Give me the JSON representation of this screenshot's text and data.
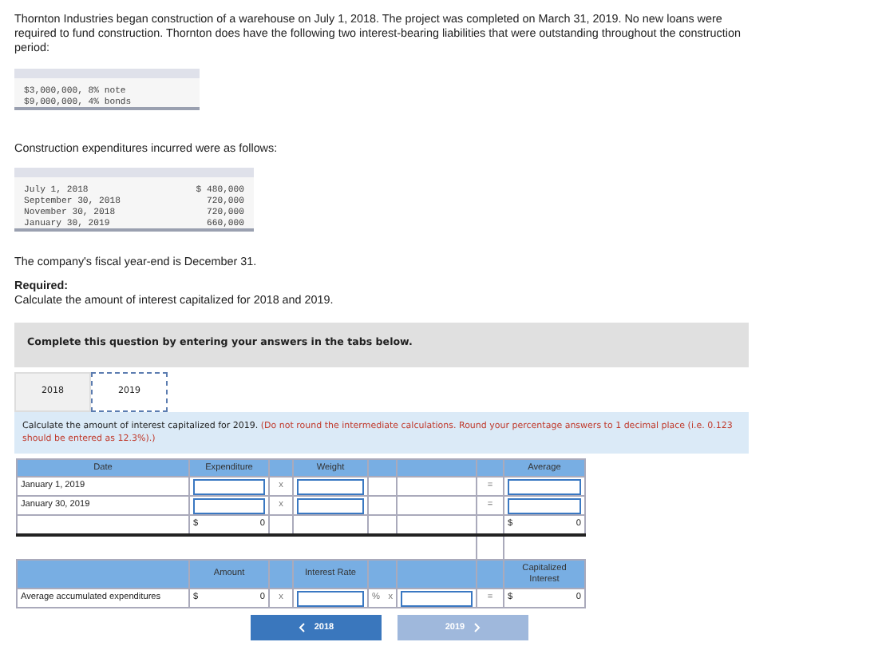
{
  "intro": "Thornton Industries began construction of a warehouse on July 1, 2018. The project was completed on March 31, 2019. No new loans were required to fund construction. Thornton does have the following two interest-bearing liabilities that were outstanding throughout the construction period:",
  "liabilities": [
    "$3,000,000, 8% note",
    "$9,000,000, 4% bonds"
  ],
  "expenditures_intro": "Construction expenditures incurred were as follows:",
  "expenditures": [
    {
      "date": "July 1, 2018",
      "amount": "$ 480,000"
    },
    {
      "date": "September 30, 2018",
      "amount": "720,000"
    },
    {
      "date": "November 30, 2018",
      "amount": "720,000"
    },
    {
      "date": "January 30, 2019",
      "amount": "660,000"
    }
  ],
  "fiscal_note": "The company's fiscal year-end is December 31.",
  "required": {
    "heading": "Required:",
    "text": "Calculate the amount of interest capitalized for 2018 and 2019."
  },
  "instruction_banner": "Complete this question by entering your answers in the tabs below.",
  "tabs": [
    {
      "label": "2018",
      "selected": false
    },
    {
      "label": "2019",
      "selected": true
    }
  ],
  "prompt": {
    "text": "Calculate the amount of interest capitalized for 2019.",
    "note": "(Do not round the intermediate calculations. Round your percentage answers to 1 decimal place (i.e. 0.123 should be entered as 12.3%).)"
  },
  "weighting_table": {
    "columns": [
      "Date",
      "Expenditure",
      "Weight",
      "Average"
    ],
    "rows": [
      {
        "date": "January 1, 2019",
        "times": "x",
        "equals": "="
      },
      {
        "date": "January 30, 2019",
        "times": "x",
        "equals": "="
      }
    ],
    "total": {
      "expenditure_currency": "$",
      "expenditure": "0",
      "average_currency": "$",
      "average": "0"
    }
  },
  "interest_table": {
    "columns": [
      "Amount",
      "Interest Rate",
      "Capitalized Interest"
    ],
    "row": {
      "label": "Average accumulated expenditures",
      "amount_currency": "$",
      "amount": "0",
      "times_1": "x",
      "percent": "%",
      "times_2": "x",
      "equals": "=",
      "result_currency": "$",
      "result": "0"
    }
  },
  "nav_buttons": [
    {
      "label": "2018",
      "kind": "prev",
      "disabled": false
    },
    {
      "label": "2019",
      "kind": "next",
      "disabled": true
    }
  ]
}
